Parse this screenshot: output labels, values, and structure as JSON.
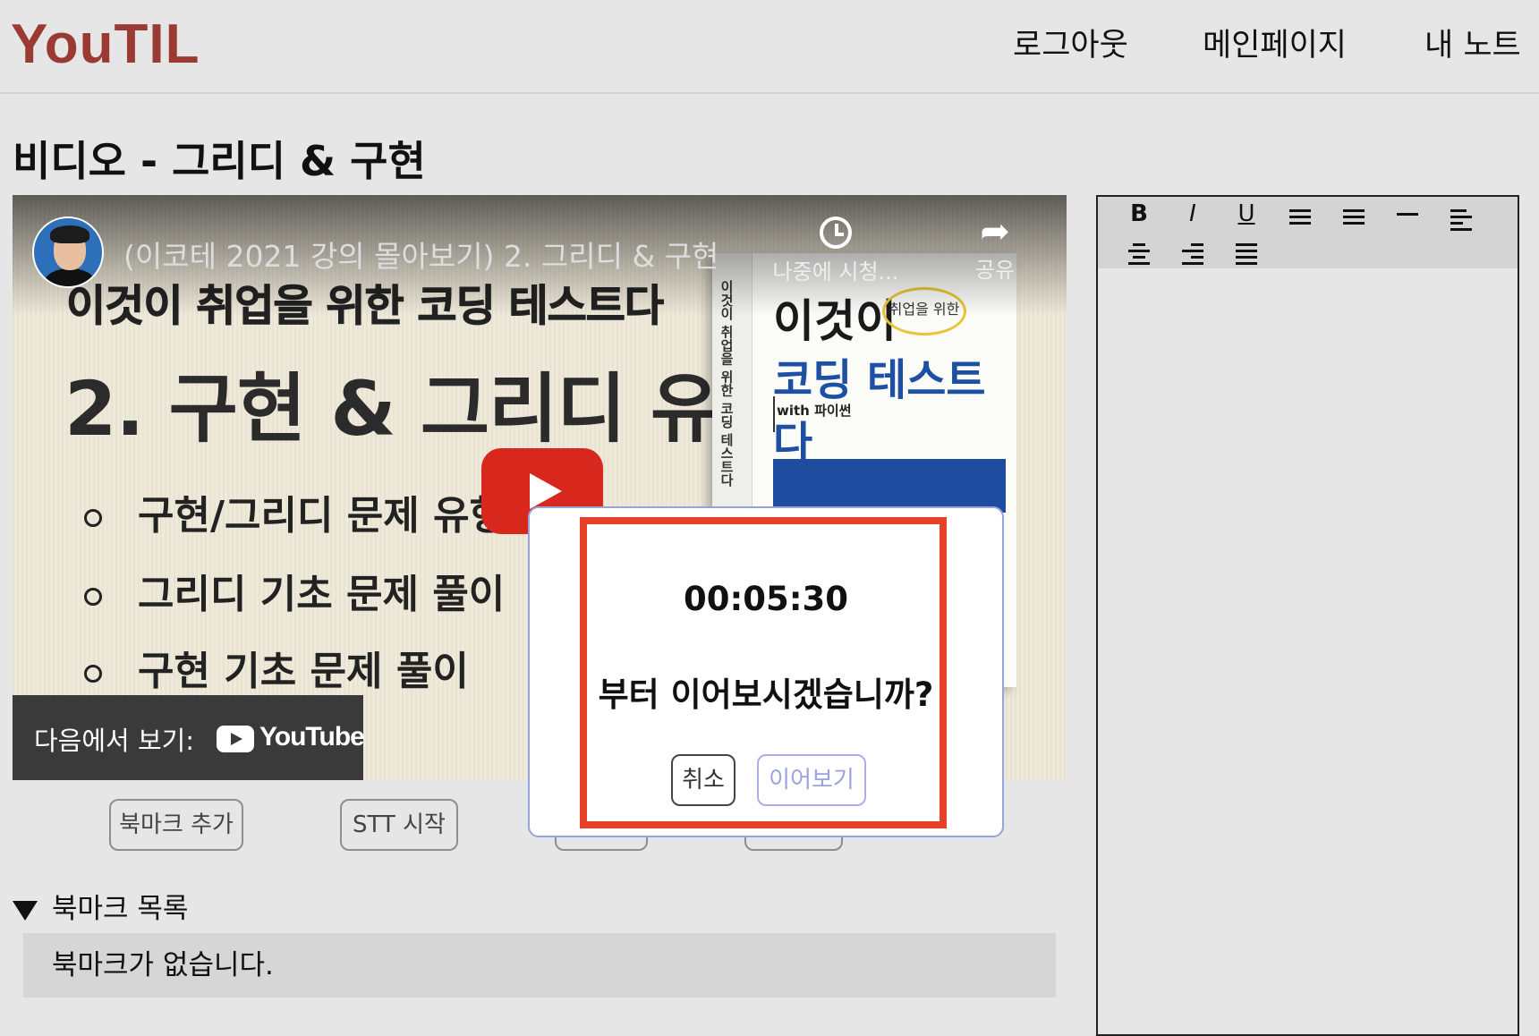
{
  "header": {
    "logo": "YouTIL",
    "nav": [
      "로그아웃",
      "메인페이지",
      "내 노트"
    ]
  },
  "page_title": "비디오 - 그리디 & 구현",
  "video": {
    "title": "(이코테 2021 강의 몰아보기) 2. 그리디 & 구현",
    "slide_subtitle": "이것이 취업을 위한 코딩 테스트다",
    "slide_heading": "2. 구현 & 그리디 유형",
    "bullets": [
      "구현/그리디 문제 유형",
      "그리디 기초 문제 풀이",
      "구현 기초 문제 풀이"
    ],
    "book": {
      "spine": "이것이 취업을 위한 코딩 테스트다",
      "line1": "이것이",
      "badge": "취업을 위한",
      "line2": "코딩 테스트다",
      "with": "with 파이썬"
    },
    "watch_later": "나중에 시청...",
    "share": "공유",
    "watch_on": "다음에서 보기:",
    "youtube": "YouTube"
  },
  "actions": {
    "add_bookmark": "북마크 추가",
    "stt_start": "STT 시작"
  },
  "bookmarks": {
    "heading": "북마크 목록",
    "empty": "북마크가 없습니다."
  },
  "editor": {
    "tools": [
      "bold",
      "italic",
      "underline",
      "bullet-list",
      "ordered-list",
      "horizontal-rule",
      "align-left",
      "align-center",
      "align-right",
      "align-justify"
    ],
    "labels": {
      "bold": "B",
      "italic": "I",
      "underline": "U"
    }
  },
  "modal": {
    "time": "00:05:30",
    "message": "부터 이어보시겠습니까?",
    "cancel": "취소",
    "resume": "이어보기"
  },
  "colors": {
    "logo": "#9b3a32",
    "highlight": "#e8412a",
    "resume_text": "#9aa3e0",
    "play": "#d8281e"
  }
}
